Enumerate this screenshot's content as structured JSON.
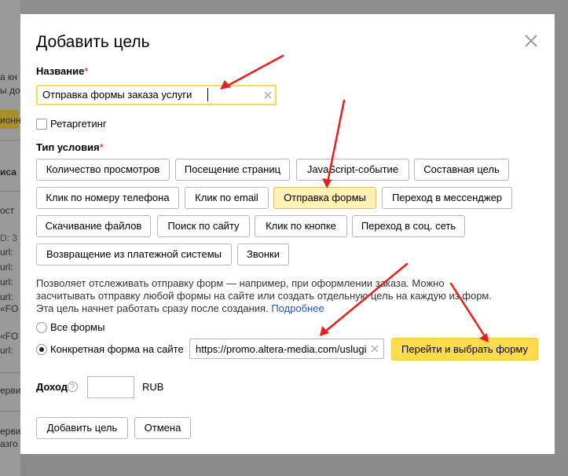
{
  "background": {
    "fragments": [
      "а кн",
      "ы до",
      "ионн",
      "иса",
      "ост",
      "D: 3",
      "url: ",
      "url: ",
      "url: ",
      "url: ",
      "«FO",
      "«FO",
      "url: ",
      "ерви",
      "ерви",
      "азго"
    ]
  },
  "dialog": {
    "title": "Добавить цель",
    "name_label": "Название",
    "required_mark": "*",
    "name_value": "Отправка формы заказа услуги",
    "retargeting_label": "Ретаргетинг",
    "condition_label": "Тип условия",
    "condition_types": [
      "Количество просмотров",
      "Посещение страниц",
      "JavaScript-событие",
      "Составная цель",
      "Клик по номеру телефона",
      "Клик по email",
      "Отправка формы",
      "Переход в мессенджер",
      "Скачивание файлов",
      "Поиск по сайту",
      "Клик по кнопке",
      "Переход в соц. сеть",
      "Возвращение из платежной системы",
      "Звонки"
    ],
    "selected_condition": "Отправка формы",
    "description": "Позволяет отслеживать отправку форм — например, при оформлении заказа. Можно засчитывать отправку любой формы на сайте или создать отдельную цель на каждую из форм. Эта цель начнет работать сразу после создания.",
    "more_link": "Подробнее",
    "radio_all": "Все формы",
    "radio_specific": "Конкретная форма на сайте",
    "url_value": "https://promo.altera-media.com/uslugi",
    "select_form_button": "Перейти и выбрать форму",
    "income_label": "Доход",
    "help_glyph": "?",
    "currency": "RUB",
    "add_button": "Добавить цель",
    "cancel_button": "Отмена"
  },
  "colors": {
    "accent": "#ffdb4d",
    "selected_option": "#fff0b3",
    "link": "#1e59b8",
    "required": "#e60000",
    "annotation_arrow": "#e8201b"
  },
  "icons": [
    "close-icon",
    "clear-icon",
    "help-icon"
  ]
}
